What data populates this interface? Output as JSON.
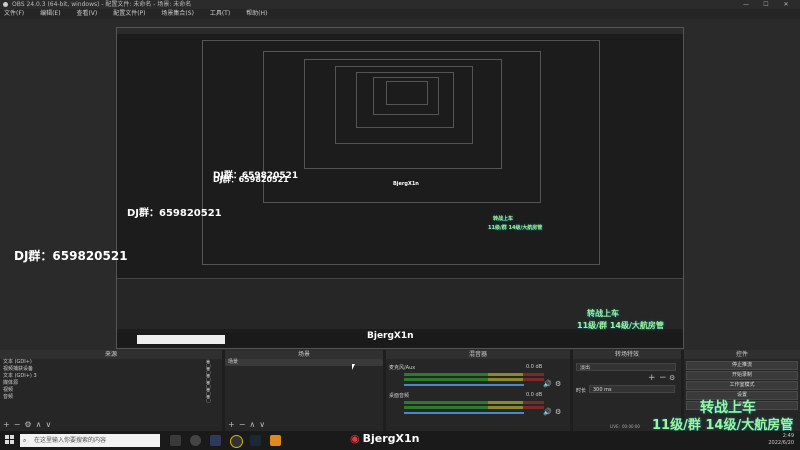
{
  "window": {
    "title": "OBS 24.0.3 (64-bit, windows) - 配置文件: 未命名 - 场景: 未命名",
    "controls": [
      "—",
      "☐",
      "✕"
    ]
  },
  "menu": [
    "文件(F)",
    "编辑(E)",
    "查看(V)",
    "配置文件(P)",
    "场景集合(S)",
    "工具(T)",
    "帮助(H)"
  ],
  "preview": {
    "dj_text": "DJ群：659820521"
  },
  "panels": {
    "sources": {
      "header": "来源",
      "items": [
        "文本 (GDI+)",
        "视频捕获设备",
        "文本 (GDI+) 3",
        "媒体源",
        "视频",
        "音频"
      ]
    },
    "scenes": {
      "header": "场景",
      "items": [
        "场景"
      ]
    },
    "mixer": {
      "header": "混音器",
      "tracks": [
        {
          "name": "麦克风/Aux",
          "db": "0.0 dB"
        },
        {
          "name": "桌面音频",
          "db": "0.0 dB"
        }
      ]
    },
    "transitions": {
      "header": "转场特效",
      "type": "淡出",
      "duration_label": "时长",
      "duration_value": "300 ms"
    },
    "controls": {
      "header": "控件",
      "buttons": [
        "停止推流",
        "开始录制",
        "工作室模式",
        "设置",
        "退出"
      ]
    }
  },
  "status": {
    "live_label": "LIVE:",
    "live_time": "00:00:00",
    "rec_label": "REC:",
    "cpu": "CPU: 4.2%, 30.00 fps"
  },
  "overlay": {
    "line1": "转战上车",
    "line2": "11级/群 14级/大航房管"
  },
  "taskbar": {
    "search_placeholder": "在这里输入你要搜索的内容",
    "watermark": "BjergX1n",
    "time": "2:49",
    "date": "2022/6/20"
  }
}
